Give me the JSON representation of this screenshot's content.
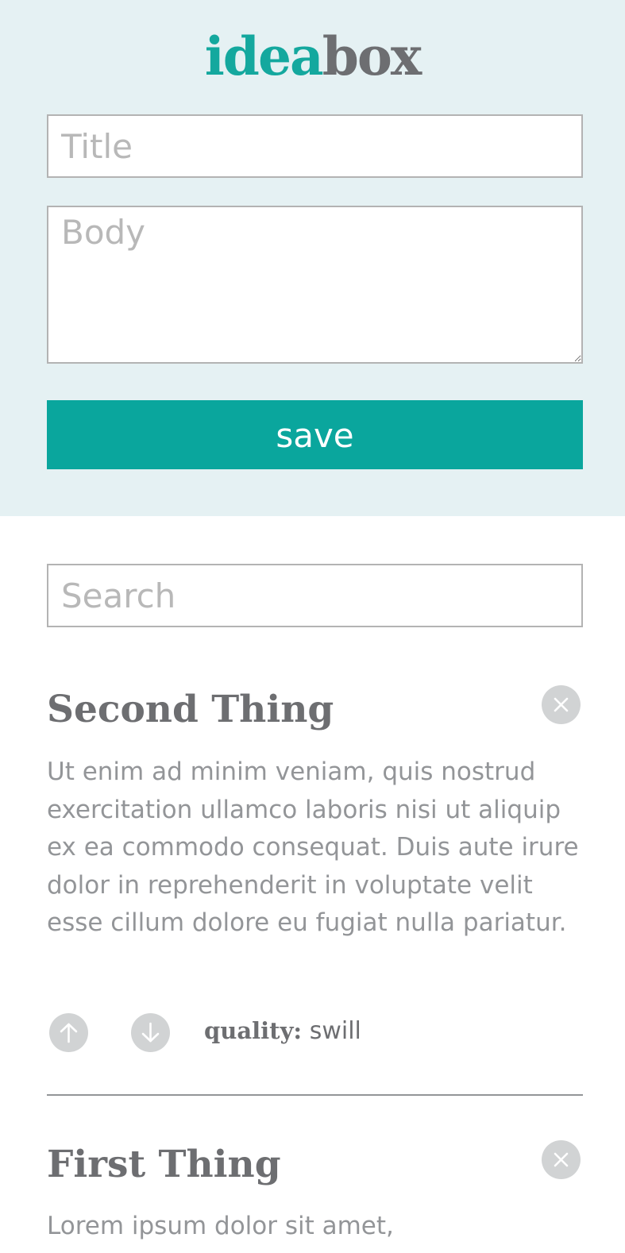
{
  "header": {
    "logo_part1": "idea",
    "logo_part2": "box"
  },
  "form": {
    "title_placeholder": "Title",
    "body_placeholder": "Body",
    "save_label": "save"
  },
  "search": {
    "placeholder": "Search"
  },
  "ideas": [
    {
      "title": "Second Thing",
      "body": "Ut enim ad minim veniam, quis nostrud exercitation ullamco laboris nisi ut aliquip ex ea commodo consequat. Duis aute irure dolor in reprehenderit in voluptate velit esse cillum dolore eu fugiat nulla pariatur.",
      "quality_label": "quality:",
      "quality_value": "swill"
    },
    {
      "title": "First Thing",
      "body": "Lorem ipsum dolor sit amet,"
    }
  ],
  "colors": {
    "accent": "#0aa69d",
    "logo_teal": "#14a89e",
    "header_bg": "#e5f1f3",
    "text_dark": "#6d6e71",
    "text_light": "#939598",
    "icon_bg": "#d1d3d4"
  },
  "icons": {
    "delete": "close-icon",
    "upvote": "arrow-up-icon",
    "downvote": "arrow-down-icon"
  }
}
